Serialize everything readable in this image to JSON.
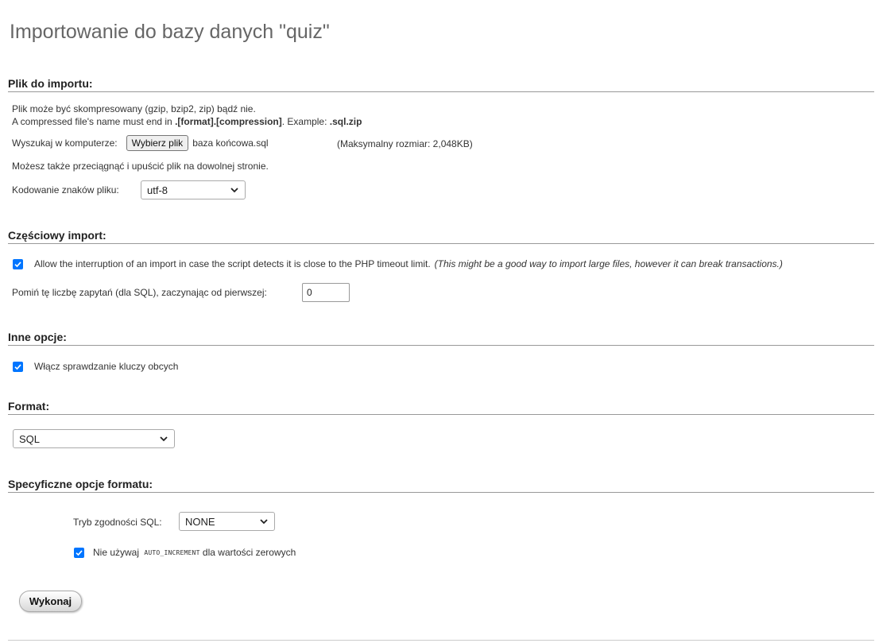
{
  "page": {
    "title": "Importowanie do bazy danych \"quiz\""
  },
  "file_section": {
    "legend": "Plik do importu:",
    "compress_note": "Plik może być skompresowany (gzip, bzip2, zip) bądź nie.",
    "name_note_prefix": "A compressed file's name must end in ",
    "name_note_format": ".[format].[compression]",
    "name_note_mid": ". Example: ",
    "name_note_example": ".sql.zip",
    "browse_label": "Wyszukaj w komputerze:",
    "choose_button": "Wybierz plik",
    "chosen_file": "baza końcowa.sql",
    "max_size": "(Maksymalny rozmiar: 2,048KB)",
    "drag_note": "Możesz także przeciągnąć i upuścić plik na dowolnej stronie.",
    "encoding_label": "Kodowanie znaków pliku:",
    "encoding_value": "utf-8"
  },
  "partial_section": {
    "legend": "Częściowy import:",
    "allow_interrupt_label": "Allow the interruption of an import in case the script detects it is close to the PHP timeout limit.",
    "allow_interrupt_note": "(This might be a good way to import large files, however it can break transactions.)",
    "allow_interrupt_checked": true,
    "skip_label": "Pomiń tę liczbę zapytań (dla SQL), zaczynając od pierwszej:",
    "skip_value": "0"
  },
  "other_section": {
    "legend": "Inne opcje:",
    "fk_label": "Włącz sprawdzanie kluczy obcych",
    "fk_checked": true
  },
  "format_section": {
    "legend": "Format:",
    "format_value": "SQL"
  },
  "specific_section": {
    "legend": "Specyficzne opcje formatu:",
    "compat_label": "Tryb zgodności SQL:",
    "compat_value": "NONE",
    "auto_inc_prefix": "Nie używaj ",
    "auto_inc_code": "AUTO_INCREMENT",
    "auto_inc_suffix": " dla wartości zerowych",
    "auto_inc_checked": true
  },
  "actions": {
    "submit": "Wykonaj"
  },
  "colors": {
    "checkbox": "#0075ff",
    "legend_rule": "#999999",
    "title": "#666666"
  },
  "icons": {
    "dropdown": "chevron-down-icon",
    "checkbox": "checkmark-icon"
  }
}
